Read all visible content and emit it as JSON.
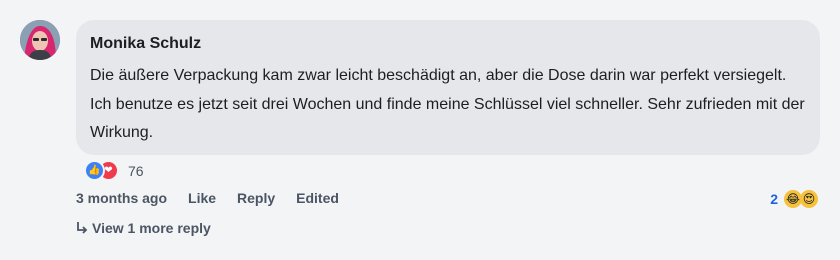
{
  "comment": {
    "author": "Monika Schulz",
    "text": "Die äußere Verpackung kam zwar leicht beschädigt an, aber die Dose darin war perfekt versiegelt. Ich benutze es jetzt seit drei Wochen und finde meine Schlüssel viel schneller. Sehr zufrieden mit der Wirkung.",
    "reactions": {
      "icons": [
        "thumbs-up-icon",
        "heart-icon"
      ],
      "count": "76"
    },
    "actions": {
      "timestamp": "3 months ago",
      "like": "Like",
      "reply": "Reply",
      "edited": "Edited"
    },
    "reply_reactions": {
      "count": "2",
      "icons": [
        "laughing-emoji-icon",
        "heart-eyes-emoji-icon"
      ]
    },
    "view_replies": "View 1 more reply"
  },
  "colors": {
    "bubble": "#e5e7eb",
    "background": "#f3f4f6",
    "link_blue": "#1d64d8",
    "like_blue": "#3b82f6",
    "love_red": "#ef3b4b"
  }
}
